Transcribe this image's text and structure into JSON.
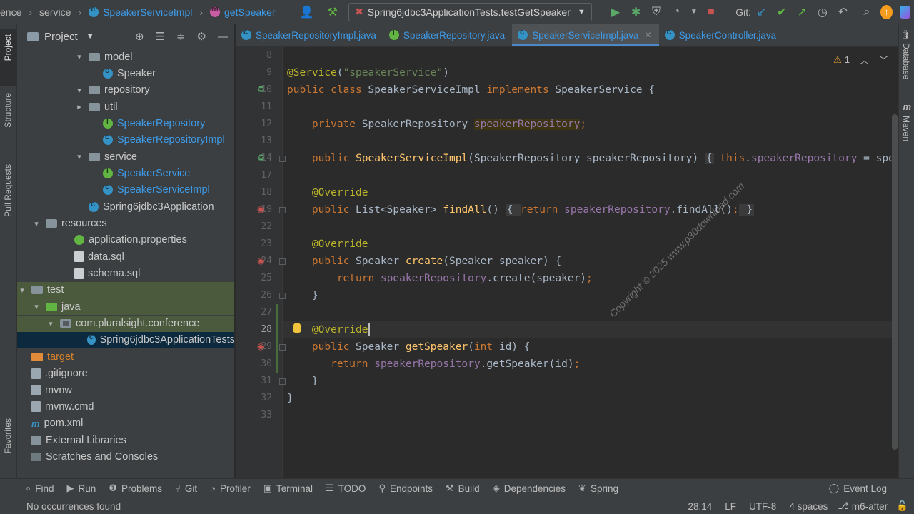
{
  "breadcrumbs": [
    {
      "label": "ence",
      "icon": "none"
    },
    {
      "label": "service",
      "icon": "none"
    },
    {
      "label": "SpeakerServiceImpl",
      "icon": "class-icon"
    },
    {
      "label": "getSpeaker",
      "icon": "method-icon"
    }
  ],
  "run_config": {
    "label": "Spring6jdbc3ApplicationTests.testGetSpeaker"
  },
  "git_label": "Git:",
  "project_panel": {
    "title": "Project",
    "tree": [
      {
        "label": "model",
        "kind": "folder",
        "arrow": "▾",
        "color": "normal"
      },
      {
        "label": "Speaker",
        "kind": "class",
        "arrow": "",
        "color": "normal"
      },
      {
        "label": "repository",
        "kind": "folder",
        "arrow": "▾",
        "color": "normal"
      },
      {
        "label": "util",
        "kind": "folder",
        "arrow": "▸",
        "color": "normal"
      },
      {
        "label": "SpeakerRepository",
        "kind": "interface",
        "arrow": "",
        "color": "blue"
      },
      {
        "label": "SpeakerRepositoryImpl",
        "kind": "class",
        "arrow": "",
        "color": "blue"
      },
      {
        "label": "service",
        "kind": "folder",
        "arrow": "▾",
        "color": "normal"
      },
      {
        "label": "SpeakerService",
        "kind": "interface",
        "arrow": "",
        "color": "blue"
      },
      {
        "label": "SpeakerServiceImpl",
        "kind": "class",
        "arrow": "",
        "color": "blue"
      },
      {
        "label": "Spring6jdbc3Application",
        "kind": "class",
        "arrow": "",
        "color": "normal"
      },
      {
        "label": "resources",
        "kind": "folder",
        "arrow": "▾",
        "color": "normal"
      },
      {
        "label": "application.properties",
        "kind": "prop",
        "arrow": "",
        "color": "normal"
      },
      {
        "label": "data.sql",
        "kind": "sql",
        "arrow": "",
        "color": "normal"
      },
      {
        "label": "schema.sql",
        "kind": "sql",
        "arrow": "",
        "color": "normal"
      },
      {
        "label": "test",
        "kind": "folder",
        "arrow": "▾",
        "color": "normal"
      },
      {
        "label": "java",
        "kind": "folder-green",
        "arrow": "▾",
        "color": "normal"
      },
      {
        "label": "com.pluralsight.conference",
        "kind": "package",
        "arrow": "▾",
        "color": "normal"
      },
      {
        "label": "Spring6jdbc3ApplicationTests",
        "kind": "class",
        "arrow": "",
        "color": "normal"
      },
      {
        "label": "target",
        "kind": "folder-orange",
        "arrow": "",
        "color": "orange"
      },
      {
        "label": ".gitignore",
        "kind": "file",
        "arrow": "",
        "color": "normal"
      },
      {
        "label": "mvnw",
        "kind": "file",
        "arrow": "",
        "color": "normal"
      },
      {
        "label": "mvnw.cmd",
        "kind": "file",
        "arrow": "",
        "color": "normal"
      },
      {
        "label": "pom.xml",
        "kind": "xml",
        "arrow": "",
        "color": "normal"
      },
      {
        "label": "External Libraries",
        "kind": "lib",
        "arrow": "",
        "color": "normal"
      },
      {
        "label": "Scratches and Consoles",
        "kind": "scratch",
        "arrow": "",
        "color": "normal"
      }
    ]
  },
  "tabs": [
    {
      "label": "SpeakerRepositoryImpl.java",
      "icon": "class-icon",
      "active": false
    },
    {
      "label": "SpeakerRepository.java",
      "icon": "interface-icon",
      "active": false
    },
    {
      "label": "SpeakerServiceImpl.java",
      "icon": "class-icon",
      "active": true
    },
    {
      "label": "SpeakerController.java",
      "icon": "class-icon",
      "active": false
    }
  ],
  "inspections": {
    "warnings": "1"
  },
  "editor": {
    "current_line": "28",
    "lines": [
      {
        "n": "8",
        "code": []
      },
      {
        "n": "9",
        "code": [
          [
            "ann",
            "@Service"
          ],
          [
            "plain",
            "("
          ],
          [
            "str",
            "\"speakerService\""
          ],
          [
            "plain",
            ")"
          ]
        ]
      },
      {
        "n": "10",
        "code": [
          [
            "kw",
            "public class "
          ],
          [
            "plain",
            "SpeakerServiceImpl "
          ],
          [
            "kw",
            "implements "
          ],
          [
            "plain",
            "SpeakerService {"
          ]
        ]
      },
      {
        "n": "11",
        "code": []
      },
      {
        "n": "12",
        "code": [
          [
            "plain",
            "    "
          ],
          [
            "kw",
            "private "
          ],
          [
            "plain",
            "SpeakerRepository "
          ],
          [
            "fldhl",
            "speakerRepository"
          ],
          [
            "kw",
            ";"
          ]
        ]
      },
      {
        "n": "13",
        "code": []
      },
      {
        "n": "14",
        "code": [
          [
            "plain",
            "    "
          ],
          [
            "kw",
            "public "
          ],
          [
            "fn",
            "SpeakerServiceImpl"
          ],
          [
            "plain",
            "(SpeakerRepository speakerRepository) "
          ],
          [
            "folded",
            "{"
          ],
          [
            "plain",
            " "
          ],
          [
            "kw",
            "this"
          ],
          [
            "plain",
            "."
          ],
          [
            "fld",
            "speakerRepository"
          ],
          [
            "plain",
            " = spe"
          ]
        ]
      },
      {
        "n": "17",
        "code": []
      },
      {
        "n": "18",
        "code": [
          [
            "plain",
            "    "
          ],
          [
            "ann",
            "@Override"
          ]
        ]
      },
      {
        "n": "19",
        "code": [
          [
            "plain",
            "    "
          ],
          [
            "kw",
            "public "
          ],
          [
            "plain",
            "List<Speaker> "
          ],
          [
            "fn",
            "findAll"
          ],
          [
            "plain",
            "() "
          ],
          [
            "folded",
            "{ "
          ],
          [
            "kw",
            "return "
          ],
          [
            "fld",
            "speakerRepository"
          ],
          [
            "plain",
            ".findAll()"
          ],
          [
            "kw",
            ";"
          ],
          [
            "folded",
            " }"
          ]
        ]
      },
      {
        "n": "22",
        "code": []
      },
      {
        "n": "23",
        "code": [
          [
            "plain",
            "    "
          ],
          [
            "ann",
            "@Override"
          ]
        ]
      },
      {
        "n": "24",
        "code": [
          [
            "plain",
            "    "
          ],
          [
            "kw",
            "public "
          ],
          [
            "plain",
            "Speaker "
          ],
          [
            "fn",
            "create"
          ],
          [
            "plain",
            "(Speaker speaker) {"
          ]
        ]
      },
      {
        "n": "25",
        "code": [
          [
            "plain",
            "        "
          ],
          [
            "kw",
            "return "
          ],
          [
            "fld",
            "speakerRepository"
          ],
          [
            "plain",
            ".create(speaker)"
          ],
          [
            "kw",
            ";"
          ]
        ]
      },
      {
        "n": "26",
        "code": [
          [
            "plain",
            "    }"
          ]
        ]
      },
      {
        "n": "27",
        "code": []
      },
      {
        "n": "28",
        "code": [
          [
            "plain",
            "    "
          ],
          [
            "ann",
            "@Override"
          ],
          [
            "caret",
            ""
          ]
        ]
      },
      {
        "n": "29",
        "code": [
          [
            "plain",
            "    "
          ],
          [
            "kw",
            "public "
          ],
          [
            "plain",
            "Speaker "
          ],
          [
            "fn",
            "getSpeaker"
          ],
          [
            "plain",
            "("
          ],
          [
            "kw",
            "int "
          ],
          [
            "plain",
            "id) {"
          ]
        ]
      },
      {
        "n": "30",
        "code": [
          [
            "plain",
            "       "
          ],
          [
            "kw",
            "return "
          ],
          [
            "fld",
            "speakerRepository"
          ],
          [
            "plain",
            ".getSpeaker(id)"
          ],
          [
            "kw",
            ";"
          ]
        ]
      },
      {
        "n": "31",
        "code": [
          [
            "plain",
            "    }"
          ]
        ]
      },
      {
        "n": "32",
        "code": [
          [
            "plain",
            "}"
          ]
        ]
      },
      {
        "n": "33",
        "code": []
      }
    ]
  },
  "watermark": "Copyright © 2025 www.p30download.com",
  "left_stripe": {
    "project": "Project",
    "structure": "Structure",
    "pull_requests": "Pull Requests",
    "favorites": "Favorites"
  },
  "right_stripe": {
    "database": "Database",
    "maven": "Maven"
  },
  "bottom_tools": [
    {
      "label": "Find",
      "icon": "search-icon"
    },
    {
      "label": "Run",
      "icon": "run-icon"
    },
    {
      "label": "Problems",
      "icon": "problems-icon"
    },
    {
      "label": "Git",
      "icon": "git-icon"
    },
    {
      "label": "Profiler",
      "icon": "profiler-icon"
    },
    {
      "label": "Terminal",
      "icon": "terminal-icon"
    },
    {
      "label": "TODO",
      "icon": "todo-icon"
    },
    {
      "label": "Endpoints",
      "icon": "endpoints-icon"
    },
    {
      "label": "Build",
      "icon": "build-icon"
    },
    {
      "label": "Dependencies",
      "icon": "dependencies-icon"
    },
    {
      "label": "Spring",
      "icon": "spring-icon"
    }
  ],
  "event_log": "Event Log",
  "status": {
    "message": "No occurrences found",
    "position": "28:14",
    "line_sep": "LF",
    "encoding": "UTF-8",
    "indent": "4 spaces",
    "branch": "m6-after"
  }
}
